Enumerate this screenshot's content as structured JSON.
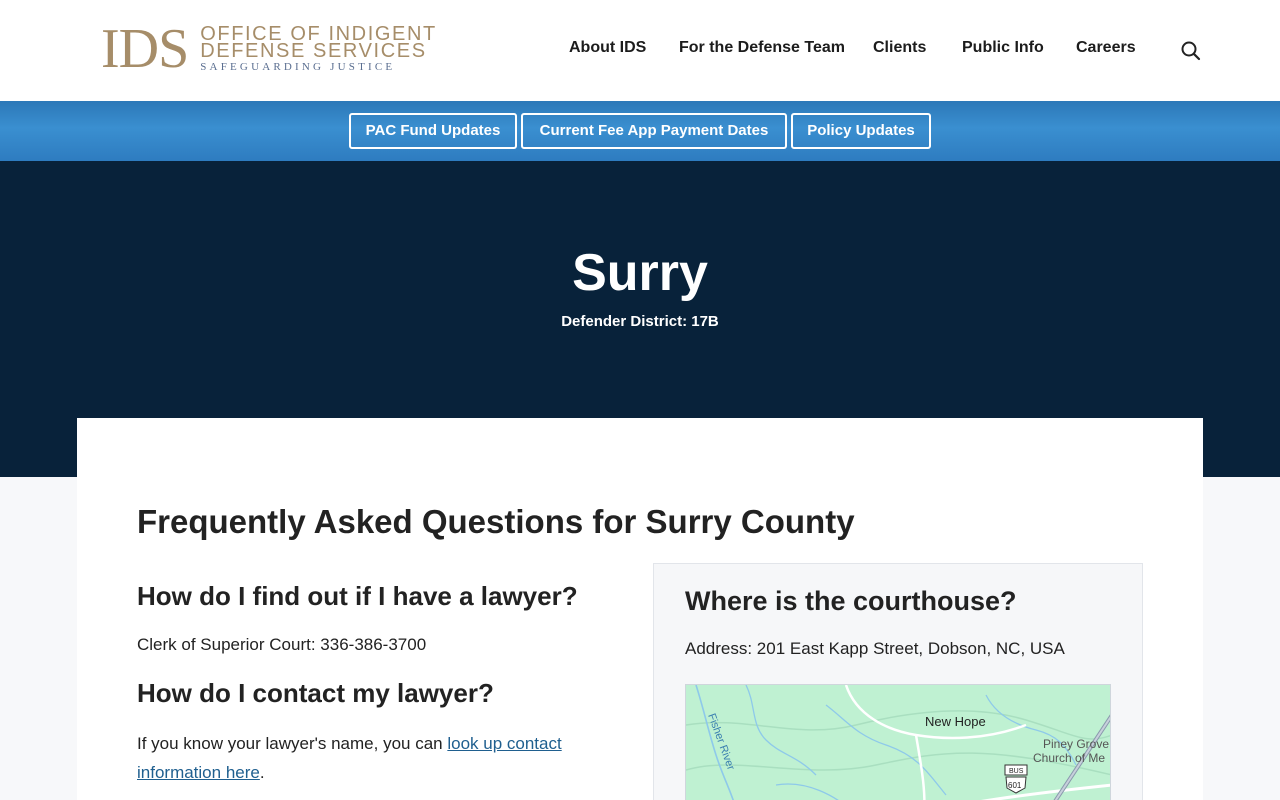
{
  "header": {
    "logo": {
      "mark": "IDS",
      "line1": "OFFICE OF INDIGENT",
      "line2": "DEFENSE SERVICES",
      "tagline": "SAFEGUARDING JUSTICE",
      "color": "#a68d69"
    },
    "nav": [
      {
        "label": "About IDS"
      },
      {
        "label": "For the Defense Team"
      },
      {
        "label": "Clients"
      },
      {
        "label": "Public Info"
      },
      {
        "label": "Careers"
      }
    ],
    "search_icon": "search-icon"
  },
  "quickbar": {
    "buttons": [
      {
        "label": "PAC Fund Updates"
      },
      {
        "label": "Current Fee App Payment Dates"
      },
      {
        "label": "Policy Updates"
      }
    ]
  },
  "hero": {
    "title": "Surry",
    "subtitle": "Defender District: 17B"
  },
  "main": {
    "heading": "Frequently Asked Questions for Surry County",
    "faq": [
      {
        "question": "How do I find out if I have a lawyer?",
        "answer": "Clerk of Superior Court: 336-386-3700"
      },
      {
        "question": "How do I contact my lawyer?",
        "answer_prefix": "If you know your lawyer's name, you can ",
        "answer_link": "look up contact information here",
        "answer_suffix": "."
      }
    ],
    "courthouse": {
      "heading": "Where is the courthouse?",
      "address": "Address: 201 East Kapp Street, Dobson, NC, USA",
      "map": {
        "labels": [
          "New Hope",
          "Piney Grove",
          "Church of Me",
          "Fisher River"
        ],
        "shields": [
          "BUS",
          "601"
        ]
      }
    }
  },
  "colors": {
    "hero_bg": "#08223a",
    "bar_blue": "#3a8fd0",
    "link": "#1f5f8f"
  }
}
